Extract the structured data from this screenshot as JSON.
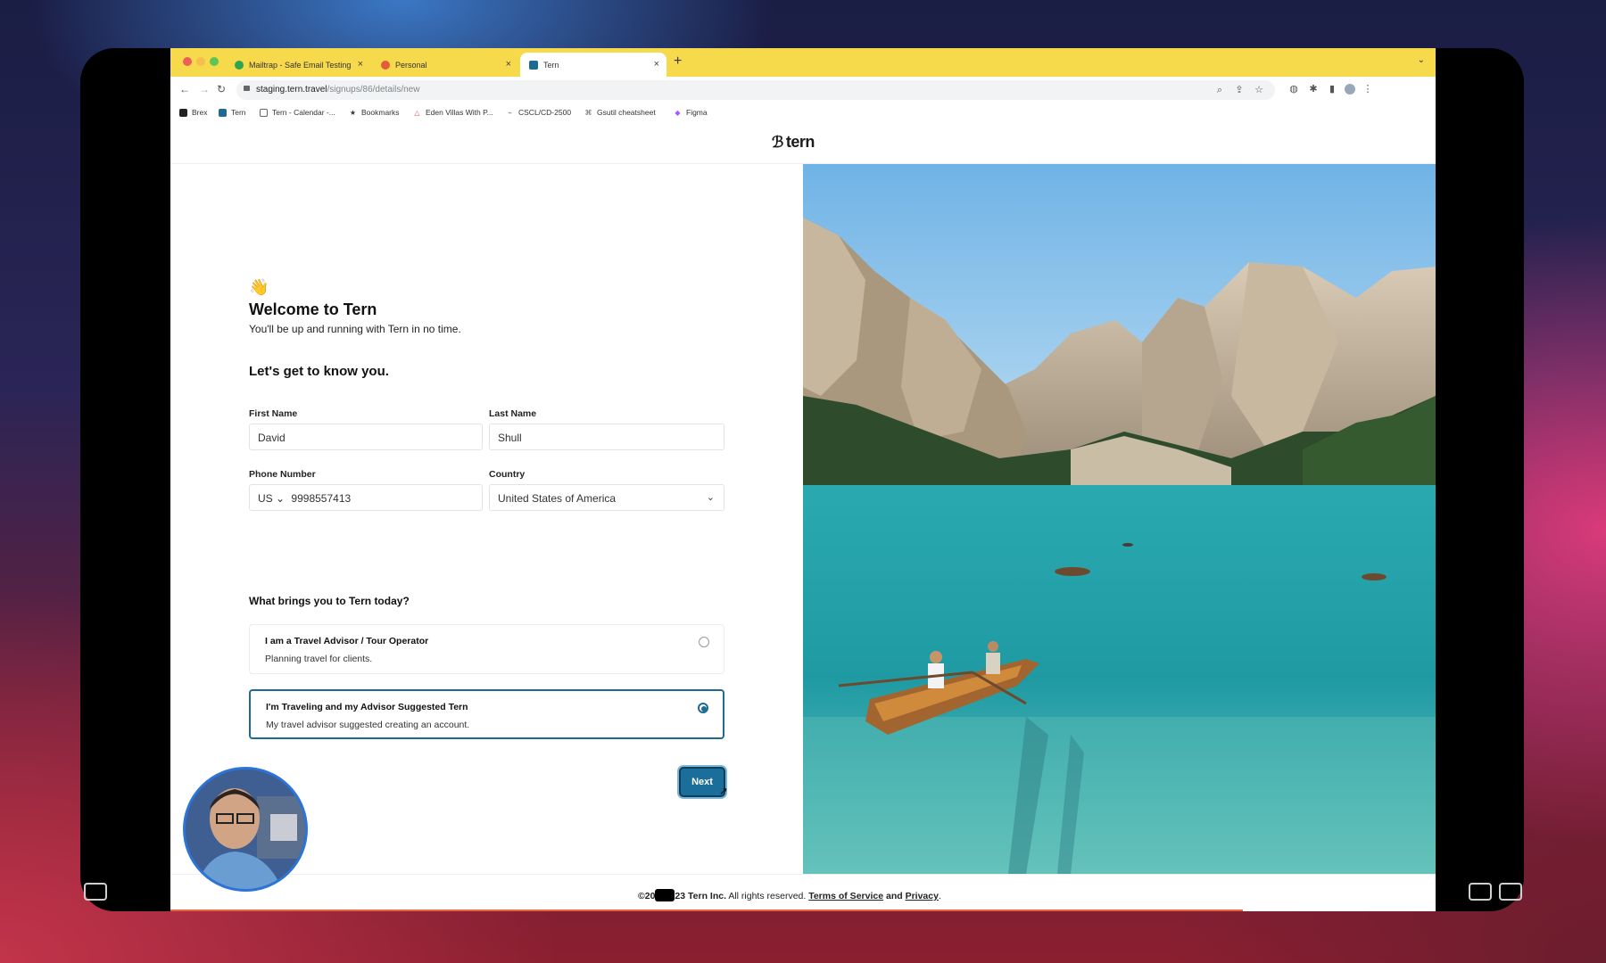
{
  "browser": {
    "tabs": [
      {
        "label": "Mailtrap - Safe Email Testing",
        "active": false,
        "favicon_color": "#2ea44f"
      },
      {
        "label": "Personal",
        "active": false,
        "favicon_color": "#e45d3a"
      },
      {
        "label": "Tern",
        "active": true,
        "favicon_color": "#1d6b93"
      }
    ],
    "tab_close": "×",
    "new_tab": "+",
    "url_domain": "staging.tern.travel",
    "url_path": "/signups/86/details/new",
    "bookmarks": [
      "Brex",
      "Tern",
      "Tern - Calendar -...",
      "Bookmarks",
      "Eden Villas With P...",
      "CSCL/CD-2500",
      "Gsutil cheatsheet",
      "Figma"
    ]
  },
  "site": {
    "logo_text": "tern"
  },
  "form": {
    "emoji": "👋",
    "title": "Welcome to Tern",
    "subtitle": "You'll be up and running with Tern in no time.",
    "section_title": "Let's get to know you.",
    "first_name_label": "First Name",
    "first_name_value": "David",
    "last_name_label": "Last Name",
    "last_name_value": "Shull",
    "phone_label": "Phone Number",
    "phone_country": "US",
    "phone_value": "9998557413",
    "country_label": "Country",
    "country_value": "United States of America",
    "question": "What brings you to Tern today?",
    "options": [
      {
        "title": "I am a Travel Advisor / Tour Operator",
        "desc": "Planning travel for clients.",
        "selected": false
      },
      {
        "title": "I'm Traveling and my Advisor Suggested Tern",
        "desc": "My travel advisor suggested creating an account.",
        "selected": true
      }
    ],
    "next_label": "Next"
  },
  "footer": {
    "prefix": "©20",
    "hidden_part": "",
    "company": "23 Tern Inc.",
    "rights": " All rights reserved. ",
    "terms": "Terms of Service",
    "and": " and ",
    "privacy": "Privacy",
    "end": "."
  },
  "colors": {
    "tabbar": "#f7d94c",
    "accent": "#1d6b93",
    "progress": "#e8643c"
  }
}
